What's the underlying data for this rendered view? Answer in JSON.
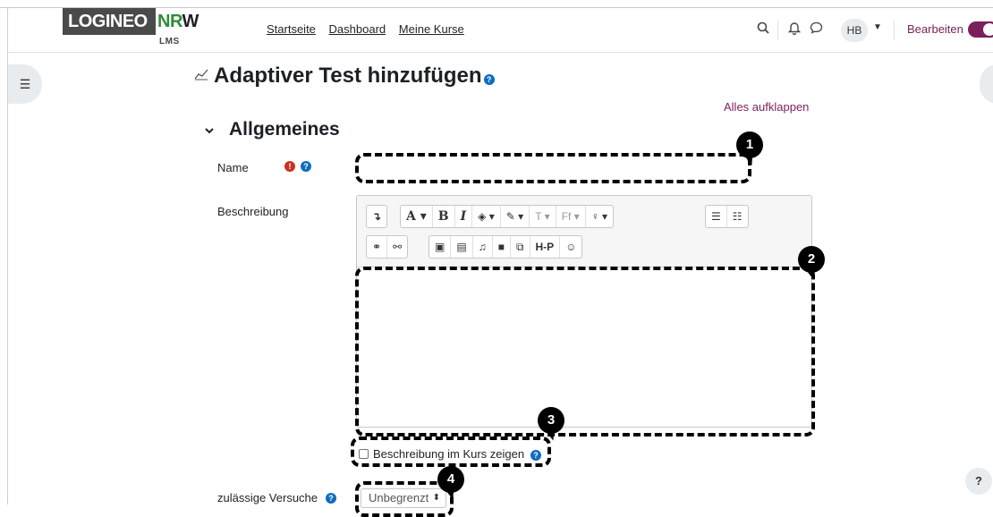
{
  "logo": {
    "brand": "LOGINEO",
    "brand_suffix_green": "NR",
    "brand_suffix_dark": "W",
    "sub": "LMS"
  },
  "nav": {
    "links": [
      "Startseite",
      "Dashboard",
      "Meine Kurse"
    ]
  },
  "user": {
    "initials": "HB",
    "edit_mode_label": "Bearbeiten",
    "edit_mode_on": true
  },
  "page": {
    "title": "Adaptiver Test hinzufügen",
    "expand_all": "Alles aufklappen"
  },
  "section": {
    "title": "Allgemeines"
  },
  "form": {
    "name_label": "Name",
    "name_value": "",
    "description_label": "Beschreibung",
    "show_description_label": "Beschreibung im Kurs zeigen",
    "show_description_checked": false,
    "attempts_label": "zulässige Versuche",
    "attempts_value": "Unbegrenzt"
  },
  "editor_toolbar": {
    "row1": [
      "↴",
      "A ▾",
      "B",
      "I",
      "◈ ▾",
      "✎ ▾",
      "T ▾",
      "Ff ▾",
      "♀ ▾",
      "☰",
      "☷"
    ],
    "row2": [
      "⚭",
      "⚯",
      "▣",
      "▤",
      "♫",
      "■",
      "⧉",
      "H-P",
      "☺"
    ]
  },
  "annotations": [
    "1",
    "2",
    "3",
    "4"
  ],
  "help_button": "?"
}
